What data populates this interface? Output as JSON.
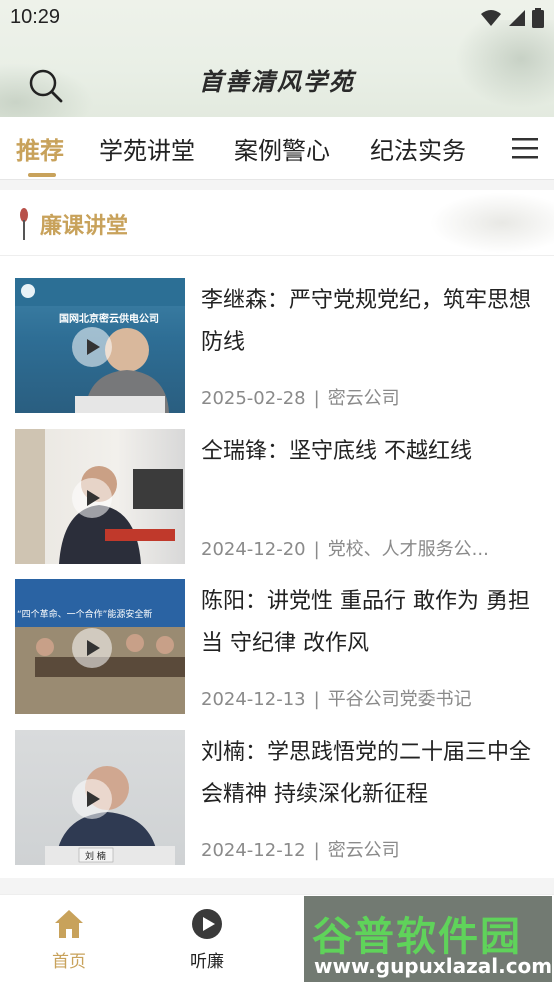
{
  "status": {
    "time": "10:29"
  },
  "app": {
    "title": "首善清风学苑"
  },
  "tabs": [
    {
      "label": "推荐",
      "active": true
    },
    {
      "label": "学苑讲堂",
      "active": false
    },
    {
      "label": "案例警心",
      "active": false
    },
    {
      "label": "纪法实务",
      "active": false
    }
  ],
  "section": {
    "title": "廉课讲堂"
  },
  "items": [
    {
      "title": "李继森：严守党规党纪，筑牢思想防线",
      "date": "2025-02-28",
      "source": "密云公司",
      "thumb_caption": "国网北京密云供电公司"
    },
    {
      "title": "仝瑞锋：坚守底线 不越红线",
      "date": "2024-12-20",
      "source": "党校、人才服务公...",
      "thumb_caption": ""
    },
    {
      "title": "陈阳：讲党性 重品行 敢作为 勇担当 守纪律 改作风",
      "date": "2024-12-13",
      "source": "平谷公司党委书记",
      "thumb_caption": "“四个革命、一个合作”能源安全新"
    },
    {
      "title": "刘楠：学思践悟党的二十届三中全会精神 持续深化新征程",
      "date": "2024-12-12",
      "source": "密云公司",
      "thumb_caption": "刘 楠"
    }
  ],
  "bottom_nav": [
    {
      "label": "首页",
      "icon": "home-icon",
      "active": true
    },
    {
      "label": "听廉",
      "icon": "play-circle-icon",
      "active": false
    }
  ],
  "watermark": {
    "top": "谷普软件园",
    "bottom": "www.gupuxlazal.com"
  },
  "colors": {
    "accent": "#c8a25b",
    "header_bg": "#e9efe6"
  }
}
